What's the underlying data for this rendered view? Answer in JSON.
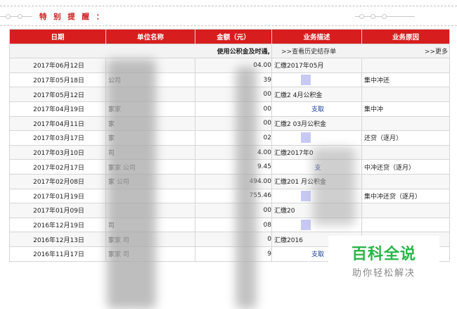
{
  "notice": {
    "title": "特 别 提 醒 ："
  },
  "table": {
    "headers": [
      "日期",
      "单位名称",
      "金额（元）",
      "业务描述",
      "业务原因"
    ],
    "subheader": {
      "label": "使用公积金及时通,",
      "history_link": ">>查看历史结存单",
      "more_link": ">>更多"
    },
    "rows": [
      {
        "date": "2017年06月12日",
        "unit": "",
        "amount": "04.00",
        "desc": "汇缴2017年05月",
        "reason": ""
      },
      {
        "date": "2017年05月18日",
        "unit": "公司",
        "amount": "39",
        "desc": "",
        "reason": "集中冲还"
      },
      {
        "date": "2017年05月12日",
        "unit": "",
        "amount": "00",
        "desc": "汇缴2 4月公积金",
        "reason": ""
      },
      {
        "date": "2017年04月19日",
        "unit": "家家",
        "amount": "00",
        "desc": "支取",
        "reason": "集中冲"
      },
      {
        "date": "2017年04月11日",
        "unit": "家",
        "amount": "00",
        "desc": "汇缴2 03月公积金",
        "reason": ""
      },
      {
        "date": "2017年03月17日",
        "unit": "家",
        "amount": "02",
        "desc": "",
        "reason": "还贷（逐月）"
      },
      {
        "date": "2017年03月10日",
        "unit": "司",
        "amount": "4.00",
        "desc": "汇缴2017年0",
        "reason": ""
      },
      {
        "date": "2017年02月17日",
        "unit": "家家 公司",
        "amount": "9.45",
        "desc": "支",
        "reason": "中冲还贷（逐月）"
      },
      {
        "date": "2017年02月08日",
        "unit": "家 公司",
        "amount": "494.00",
        "desc": "汇缴201 月公积金",
        "reason": ""
      },
      {
        "date": "2017年01月19日",
        "unit": "",
        "amount": "755.46",
        "desc": "",
        "reason": "集中冲还贷（逐月）"
      },
      {
        "date": "2017年01月09日",
        "unit": "",
        "amount": "00",
        "desc": "汇缴20",
        "reason": ""
      },
      {
        "date": "2016年12月19日",
        "unit": "司",
        "amount": "08",
        "desc": "",
        "reason": ""
      },
      {
        "date": "2016年12月13日",
        "unit": "家家 司",
        "amount": "0",
        "desc": "汇缴2016",
        "reason": ""
      },
      {
        "date": "2016年11月17日",
        "unit": "家家 司",
        "amount": "9",
        "desc": "支取",
        "reason": "集中冲还贷（逐月）"
      }
    ]
  },
  "watermark": {
    "main": "百科全说",
    "sub": "助你轻松解决"
  },
  "colors": {
    "header_red": "#d71d1d",
    "watermark_green": "#2ab64a",
    "link_blue": "#1a3d9a"
  }
}
